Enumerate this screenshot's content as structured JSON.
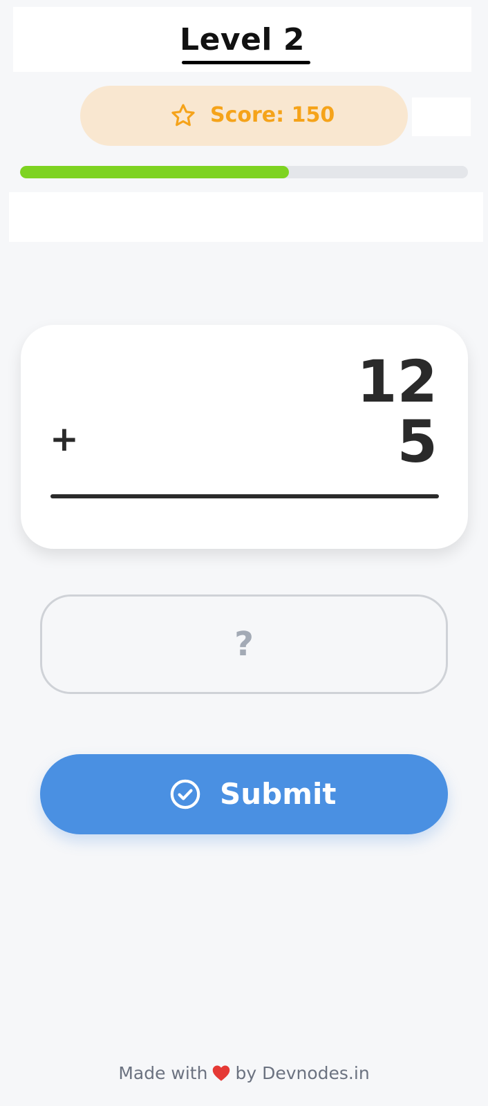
{
  "header": {
    "level_title": "Level 2"
  },
  "score": {
    "label": "Score: 150",
    "icon": "star-icon"
  },
  "progress": {
    "fraction": 0.6
  },
  "problem": {
    "operand_a": "12",
    "operator": "+",
    "operand_b": "5"
  },
  "answer": {
    "placeholder": "?",
    "value": ""
  },
  "submit": {
    "label": "Submit",
    "icon": "check-circle-icon"
  },
  "footer": {
    "prefix": "Made with",
    "heart_icon": "heart-icon",
    "suffix": "by Devnodes.in"
  },
  "colors": {
    "background": "#f6f7f9",
    "score_pill": "#f9e7d0",
    "score_text": "#f5a31a",
    "progress_fill": "#7ed321",
    "progress_track": "#e4e6ea",
    "submit_button": "#4a90e2",
    "heart": "#e53935"
  }
}
